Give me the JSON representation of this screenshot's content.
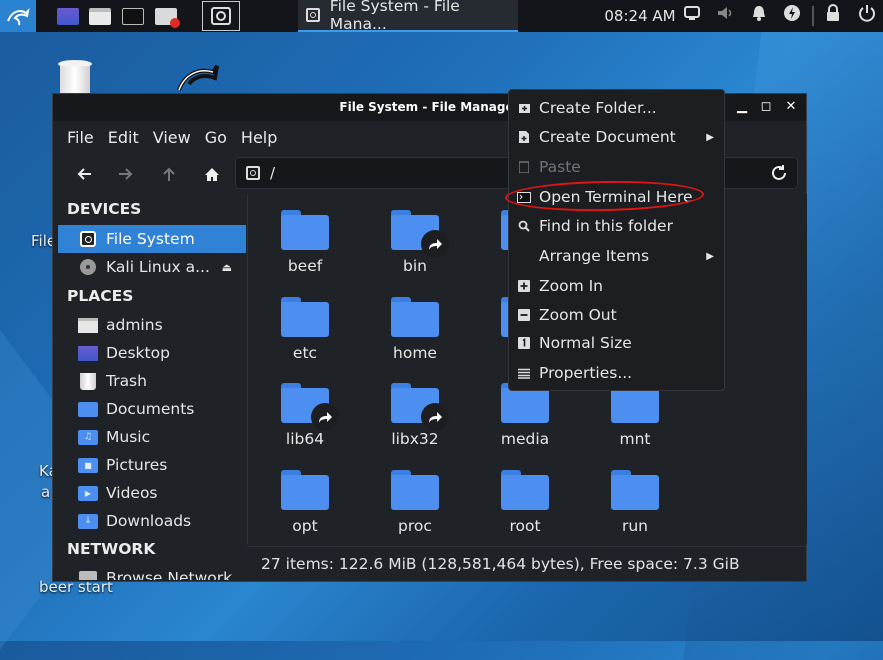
{
  "panel": {
    "task_title": "File System - File Mana...",
    "clock": "08:24 AM"
  },
  "desktop": {
    "labels": [
      "File",
      "Ka",
      "a",
      "beer start"
    ]
  },
  "window": {
    "title": "File System - File Manager",
    "menu": [
      "File",
      "Edit",
      "View",
      "Go",
      "Help"
    ],
    "path": "/",
    "sidebar": {
      "devices_heading": "DEVICES",
      "devices": [
        "File System",
        "Kali Linux a..."
      ],
      "places_heading": "PLACES",
      "places": [
        "admins",
        "Desktop",
        "Trash",
        "Documents",
        "Music",
        "Pictures",
        "Videos",
        "Downloads"
      ],
      "network_heading": "NETWORK",
      "network": [
        "Browse Network"
      ]
    },
    "files": [
      "beef",
      "bin",
      "etc",
      "home",
      "lib64",
      "libx32",
      "media",
      "mnt",
      "opt",
      "proc",
      "root",
      "run"
    ],
    "status": "27 items: 122.6 MiB (128,581,464 bytes), Free space: 7.3 GiB"
  },
  "context_menu": {
    "items": [
      "Create Folder...",
      "Create Document",
      "Paste",
      "Open Terminal Here",
      "Find in this folder",
      "Arrange Items",
      "Zoom In",
      "Zoom Out",
      "Normal Size",
      "Properties..."
    ]
  },
  "colors": {
    "accent": "#2f82d5",
    "folder": "#4d8ff0",
    "annotation": "#e01515"
  }
}
